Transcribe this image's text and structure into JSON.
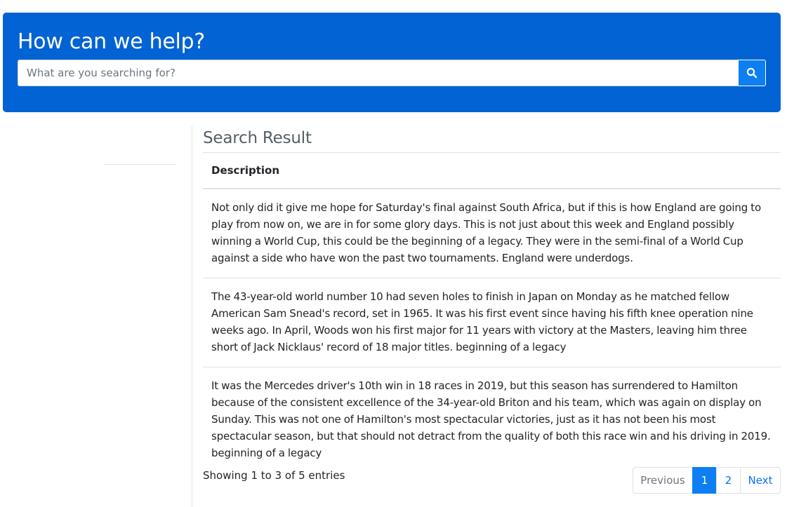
{
  "header": {
    "title": "How can we help?",
    "search_placeholder": "What are you searching for?",
    "search_icon": "search-icon",
    "accent_color": "#0263d4"
  },
  "main": {
    "section_title": "Search Result",
    "table": {
      "columns": [
        "Description"
      ],
      "rows": [
        "Not only did it give me hope for Saturday's final against South Africa, but if this is how England are going to play from now on, we are in for some glory days. This is not just about this week and England possibly winning a World Cup, this could be the beginning of a legacy. They were in the semi-final of a World Cup against a side who have won the past two tournaments. England were underdogs.",
        "The 43-year-old world number 10 had seven holes to finish in Japan on Monday as he matched fellow American Sam Snead's record, set in 1965. It was his first event since having his fifth knee operation nine weeks ago. In April, Woods won his first major for 11 years with victory at the Masters, leaving him three short of Jack Nicklaus' record of 18 major titles. beginning of a legacy",
        "It was the Mercedes driver's 10th win in 18 races in 2019, but this season has surrendered to Hamilton because of the consistent excellence of the 34-year-old Briton and his team, which was again on display on Sunday. This was not one of Hamilton's most spectacular victories, just as it has not been his most spectacular season, but that should not detract from the quality of both this race win and his driving in 2019. beginning of a legacy"
      ]
    },
    "info": "Showing 1 to 3 of 5 entries",
    "pagination": {
      "previous": "Previous",
      "pages": [
        "1",
        "2"
      ],
      "active_page": "1",
      "next": "Next"
    }
  }
}
